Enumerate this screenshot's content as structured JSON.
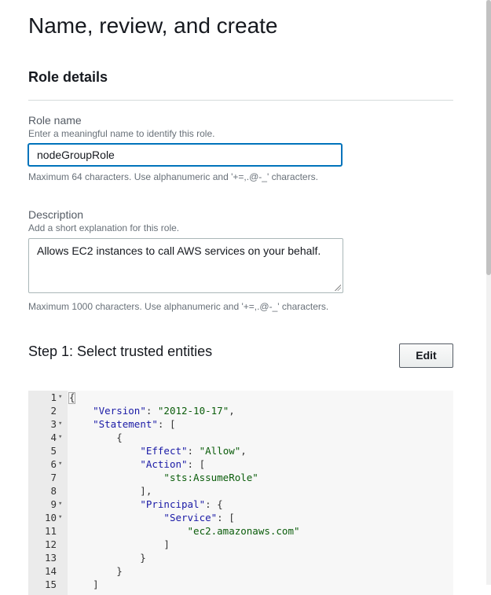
{
  "page": {
    "title": "Name, review, and create"
  },
  "role_details": {
    "title": "Role details",
    "role_name": {
      "label": "Role name",
      "hint": "Enter a meaningful name to identify this role.",
      "value": "nodeGroupRole",
      "constraint": "Maximum 64 characters. Use alphanumeric and '+=,.@-_' characters."
    },
    "description": {
      "label": "Description",
      "hint": "Add a short explanation for this role.",
      "value": "Allows EC2 instances to call AWS services on your behalf.",
      "constraint": "Maximum 1000 characters. Use alphanumeric and '+=,.@-_' characters."
    }
  },
  "step1": {
    "title": "Step 1: Select trusted entities",
    "edit_label": "Edit"
  },
  "policy_lines": [
    {
      "n": "1",
      "fold": true,
      "text": "{"
    },
    {
      "n": "2",
      "fold": false,
      "text": "    \"Version\": \"2012-10-17\","
    },
    {
      "n": "3",
      "fold": true,
      "text": "    \"Statement\": ["
    },
    {
      "n": "4",
      "fold": true,
      "text": "        {"
    },
    {
      "n": "5",
      "fold": false,
      "text": "            \"Effect\": \"Allow\","
    },
    {
      "n": "6",
      "fold": true,
      "text": "            \"Action\": ["
    },
    {
      "n": "7",
      "fold": false,
      "text": "                \"sts:AssumeRole\""
    },
    {
      "n": "8",
      "fold": false,
      "text": "            ],"
    },
    {
      "n": "9",
      "fold": true,
      "text": "            \"Principal\": {"
    },
    {
      "n": "10",
      "fold": true,
      "text": "                \"Service\": ["
    },
    {
      "n": "11",
      "fold": false,
      "text": "                    \"ec2.amazonaws.com\""
    },
    {
      "n": "12",
      "fold": false,
      "text": "                ]"
    },
    {
      "n": "13",
      "fold": false,
      "text": "            }"
    },
    {
      "n": "14",
      "fold": false,
      "text": "        }"
    },
    {
      "n": "15",
      "fold": false,
      "text": "    ]"
    }
  ],
  "colors": {
    "accent": "#0073bb",
    "code_key": "#1a1aa6",
    "code_value": "#0b5d0b"
  }
}
